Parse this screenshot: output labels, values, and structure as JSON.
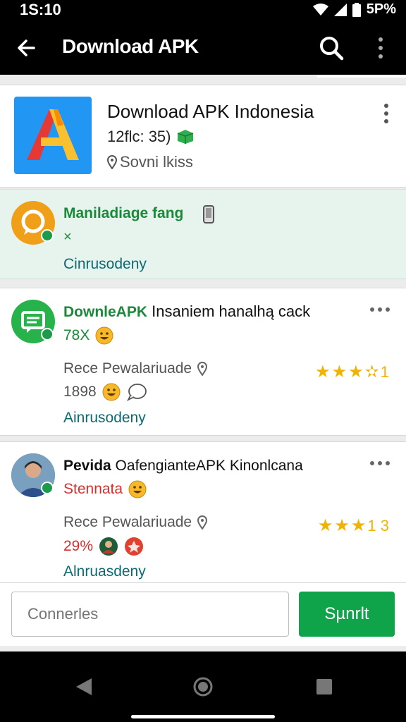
{
  "status": {
    "time": "1S:10",
    "battery_text": "5P%"
  },
  "app_bar": {
    "title": "Download APK",
    "icons": [
      "back-arrow-icon",
      "search-icon",
      "more-vert-icon"
    ]
  },
  "app_card": {
    "name": "Download APK Indonesia",
    "meta": "12flc: 35)",
    "location": "Sovni lkiss",
    "icon": "letter-a-logo"
  },
  "highlight": {
    "title": "Maniladiage fang",
    "sub": "×",
    "link": "Cinrusodeny"
  },
  "items": [
    {
      "title_green": "DownleAPK",
      "title_rest": " Insaniem hanalhą cack",
      "sub": "78X",
      "detail": "Rece Pewalariuade",
      "count": "1898",
      "rating_suffix": "1",
      "link": "Ainrusodeny"
    },
    {
      "title_bold": "Pevida",
      "title_rest": " OafengianteAPK Kinonlcana",
      "sub": "Stennata",
      "detail": "Rece Pewalariuade",
      "count": "29%",
      "rating_suffix": "1 3",
      "link": "Alnruasdeny"
    }
  ],
  "input": {
    "placeholder": "Connerles"
  },
  "submit": {
    "label": "Sµnrlt"
  },
  "colors": {
    "accent_green": "#0fa34a",
    "link_teal": "#0c6a73",
    "star": "#f2b300"
  }
}
